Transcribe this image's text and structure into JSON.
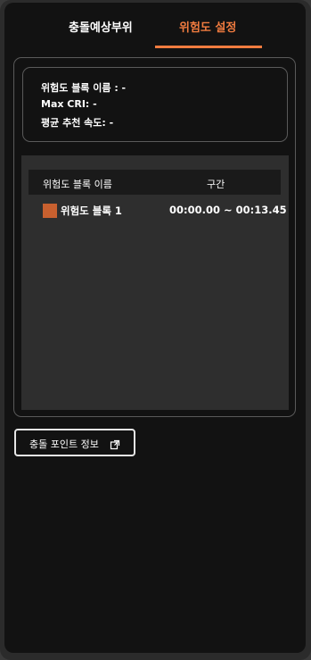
{
  "tabs": [
    {
      "label": "충돌예상부위",
      "active": false
    },
    {
      "label": "위험도 설정",
      "active": true
    }
  ],
  "colors": {
    "accent": "#f07b3f",
    "block_swatch": "#c8602f"
  },
  "summary": {
    "block_name_line": "위험도 블록 이름 : -",
    "max_cri_line": "Max CRI: -",
    "avg_speed_line": "평균 추천 속도: -"
  },
  "table": {
    "headers": {
      "name": "위험도 블록 이름",
      "range": "구간"
    },
    "rows": [
      {
        "name": "위험도 블록 1",
        "range": "00:00.00 ~ 00:13.45"
      }
    ]
  },
  "info_button": {
    "label": "충돌 포인트 정보",
    "icon": "external-link-icon"
  }
}
